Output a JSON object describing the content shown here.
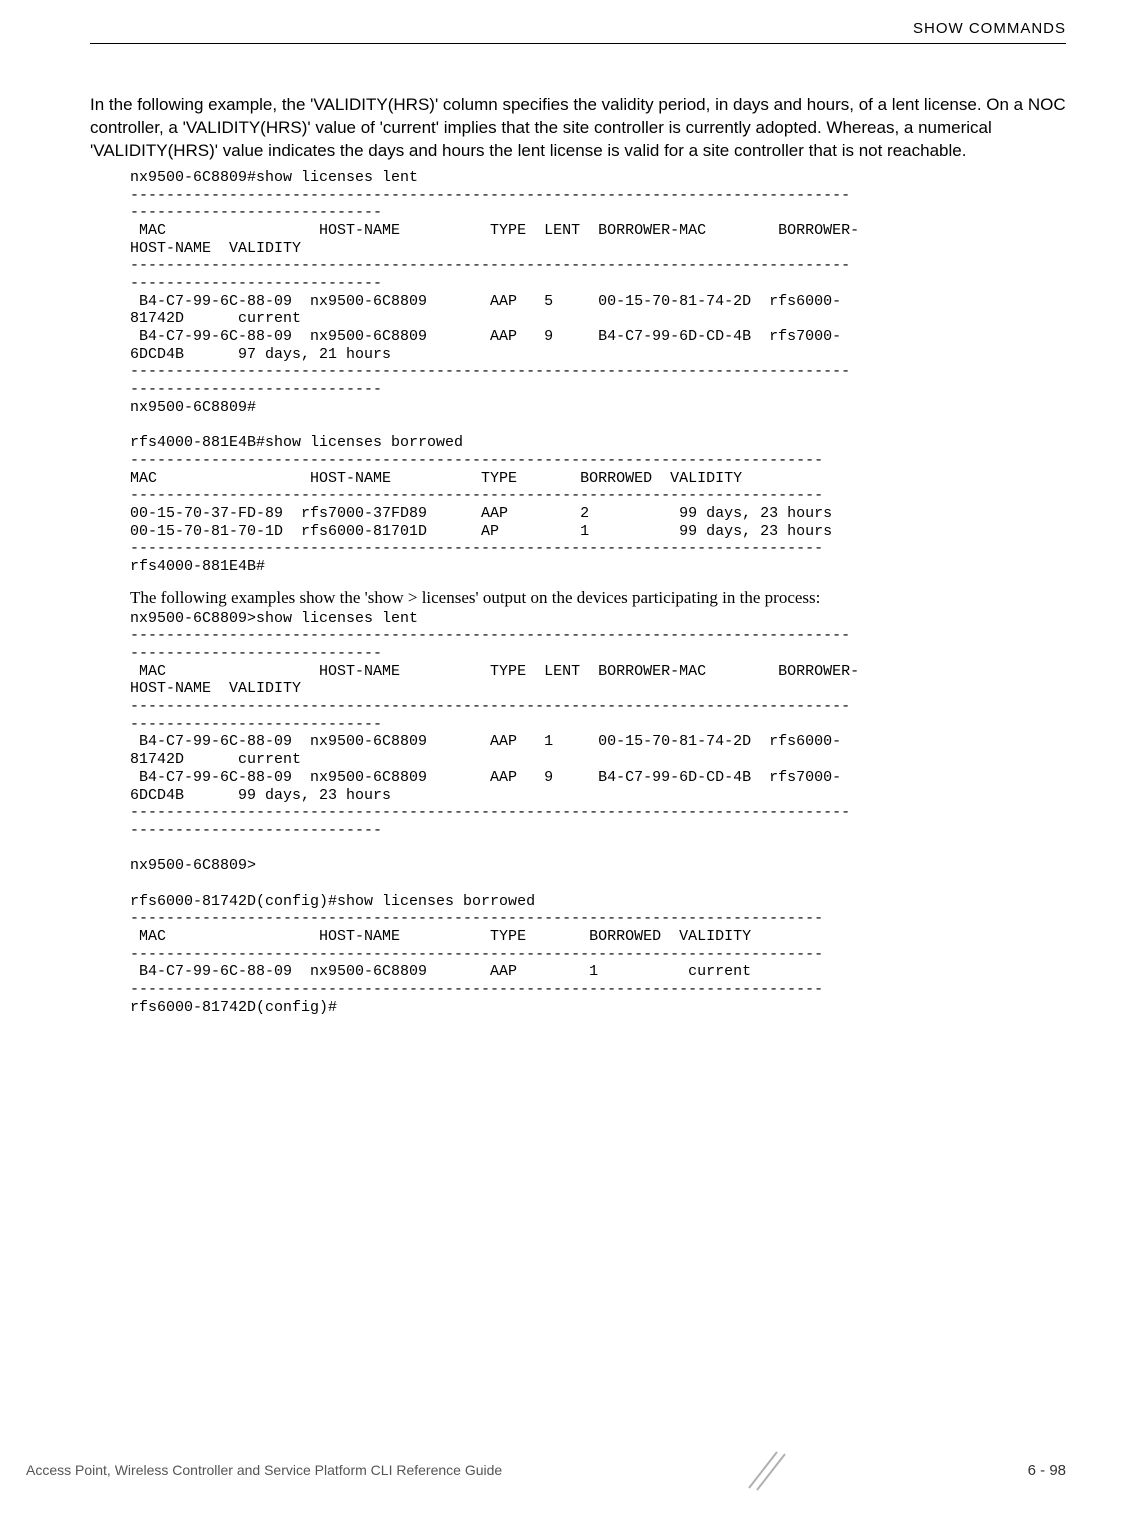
{
  "header": {
    "section_title": "SHOW COMMANDS"
  },
  "intro": "In the following example, the 'VALIDITY(HRS)' column specifies the validity period, in days and hours, of a lent license. On a NOC controller, a 'VALIDITY(HRS)' value of 'current' implies that the site controller is currently adopted. Whereas, a numerical 'VALIDITY(HRS)' value indicates the days and hours the lent license is valid for a site controller that is not reachable.",
  "code_block_1": "nx9500-6C8809#show licenses lent\n--------------------------------------------------------------------------------\n----------------------------\n MAC                 HOST-NAME          TYPE  LENT  BORROWER-MAC        BORROWER-\nHOST-NAME  VALIDITY\n--------------------------------------------------------------------------------\n----------------------------\n B4-C7-99-6C-88-09  nx9500-6C8809       AAP   5     00-15-70-81-74-2D  rfs6000-\n81742D      current\n B4-C7-99-6C-88-09  nx9500-6C8809       AAP   9     B4-C7-99-6D-CD-4B  rfs7000-\n6DCD4B      97 days, 21 hours\n--------------------------------------------------------------------------------\n----------------------------\nnx9500-6C8809#\n\nrfs4000-881E4B#show licenses borrowed\n-----------------------------------------------------------------------------\nMAC                 HOST-NAME          TYPE       BORROWED  VALIDITY\n-----------------------------------------------------------------------------\n00-15-70-37-FD-89  rfs7000-37FD89      AAP        2          99 days, 23 hours\n00-15-70-81-70-1D  rfs6000-81701D      AP         1          99 days, 23 hours\n-----------------------------------------------------------------------------\nrfs4000-881E4B#",
  "subnote": "The following examples show the 'show > licenses' output on the devices participating in the process:",
  "code_block_2": "nx9500-6C8809>show licenses lent\n--------------------------------------------------------------------------------\n----------------------------\n MAC                 HOST-NAME          TYPE  LENT  BORROWER-MAC        BORROWER-\nHOST-NAME  VALIDITY\n--------------------------------------------------------------------------------\n----------------------------\n B4-C7-99-6C-88-09  nx9500-6C8809       AAP   1     00-15-70-81-74-2D  rfs6000-\n81742D      current\n B4-C7-99-6C-88-09  nx9500-6C8809       AAP   9     B4-C7-99-6D-CD-4B  rfs7000-\n6DCD4B      99 days, 23 hours\n--------------------------------------------------------------------------------\n----------------------------\n\nnx9500-6C8809>\n\nrfs6000-81742D(config)#show licenses borrowed\n-----------------------------------------------------------------------------\n MAC                 HOST-NAME          TYPE       BORROWED  VALIDITY\n-----------------------------------------------------------------------------\n B4-C7-99-6C-88-09  nx9500-6C8809       AAP        1          current\n-----------------------------------------------------------------------------\nrfs6000-81742D(config)#",
  "footer": {
    "text": "Access Point, Wireless Controller and Service Platform CLI Reference Guide",
    "page": "6 - 98"
  }
}
